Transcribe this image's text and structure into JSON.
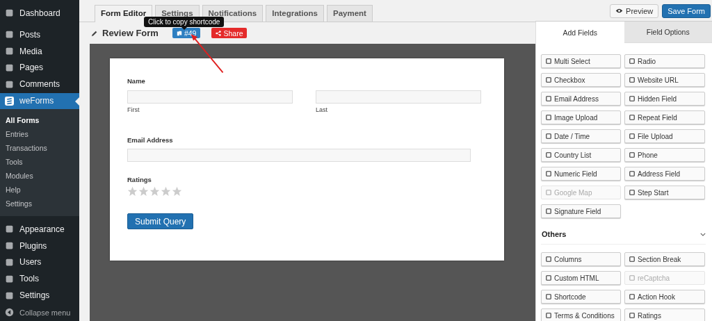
{
  "sidebar": {
    "items": [
      {
        "label": "Dashboard",
        "selected": false
      },
      {
        "label": "Posts",
        "selected": false
      },
      {
        "label": "Media",
        "selected": false
      },
      {
        "label": "Pages",
        "selected": false
      },
      {
        "label": "Comments",
        "selected": false
      },
      {
        "label": "weForms",
        "selected": true,
        "children": [
          {
            "label": "All Forms",
            "selected": true
          },
          {
            "label": "Entries",
            "selected": false
          },
          {
            "label": "Transactions",
            "selected": false
          },
          {
            "label": "Tools",
            "selected": false
          },
          {
            "label": "Modules",
            "selected": false
          },
          {
            "label": "Help",
            "selected": false
          },
          {
            "label": "Settings",
            "selected": false
          }
        ]
      },
      {
        "label": "Appearance",
        "selected": false
      },
      {
        "label": "Plugins",
        "selected": false
      },
      {
        "label": "Users",
        "selected": false
      },
      {
        "label": "Tools",
        "selected": false
      },
      {
        "label": "Settings",
        "selected": false
      }
    ],
    "collapse": "Collapse menu"
  },
  "tabs": [
    {
      "label": "Form Editor",
      "selected": true
    },
    {
      "label": "Settings",
      "selected": false
    },
    {
      "label": "Notifications",
      "selected": false
    },
    {
      "label": "Integrations",
      "selected": false
    },
    {
      "label": "Payment",
      "selected": false
    }
  ],
  "tooltip": "Click to copy shortcode",
  "form_title": "Review Form",
  "shortcode": "#49",
  "share": "Share",
  "preview": "Preview",
  "save": "Save Form",
  "form": {
    "name_label": "Name",
    "first": "First",
    "last": "Last",
    "email_label": "Email Address",
    "ratings_label": "Ratings",
    "stars": 0,
    "submit": "Submit Query"
  },
  "panel": {
    "tabs": [
      {
        "label": "Add Fields",
        "selected": true
      },
      {
        "label": "Field Options",
        "selected": false
      }
    ],
    "fields": [
      {
        "label": "Multi Select",
        "disabled": false
      },
      {
        "label": "Radio",
        "disabled": false
      },
      {
        "label": "Checkbox",
        "disabled": false
      },
      {
        "label": "Website URL",
        "disabled": false
      },
      {
        "label": "Email Address",
        "disabled": false
      },
      {
        "label": "Hidden Field",
        "disabled": false
      },
      {
        "label": "Image Upload",
        "disabled": false
      },
      {
        "label": "Repeat Field",
        "disabled": false
      },
      {
        "label": "Date / Time",
        "disabled": false
      },
      {
        "label": "File Upload",
        "disabled": false
      },
      {
        "label": "Country List",
        "disabled": false
      },
      {
        "label": "Phone",
        "disabled": false
      },
      {
        "label": "Numeric Field",
        "disabled": false
      },
      {
        "label": "Address Field",
        "disabled": false
      },
      {
        "label": "Google Map",
        "disabled": true
      },
      {
        "label": "Step Start",
        "disabled": false
      },
      {
        "label": "Signature Field",
        "disabled": false
      }
    ],
    "others_title": "Others",
    "others_expanded": true,
    "others": [
      {
        "label": "Columns",
        "disabled": false
      },
      {
        "label": "Section Break",
        "disabled": false
      },
      {
        "label": "Custom HTML",
        "disabled": false
      },
      {
        "label": "reCaptcha",
        "disabled": true
      },
      {
        "label": "Shortcode",
        "disabled": false
      },
      {
        "label": "Action Hook",
        "disabled": false
      },
      {
        "label": "Terms & Conditions",
        "disabled": false
      },
      {
        "label": "Ratings",
        "disabled": false
      }
    ]
  }
}
